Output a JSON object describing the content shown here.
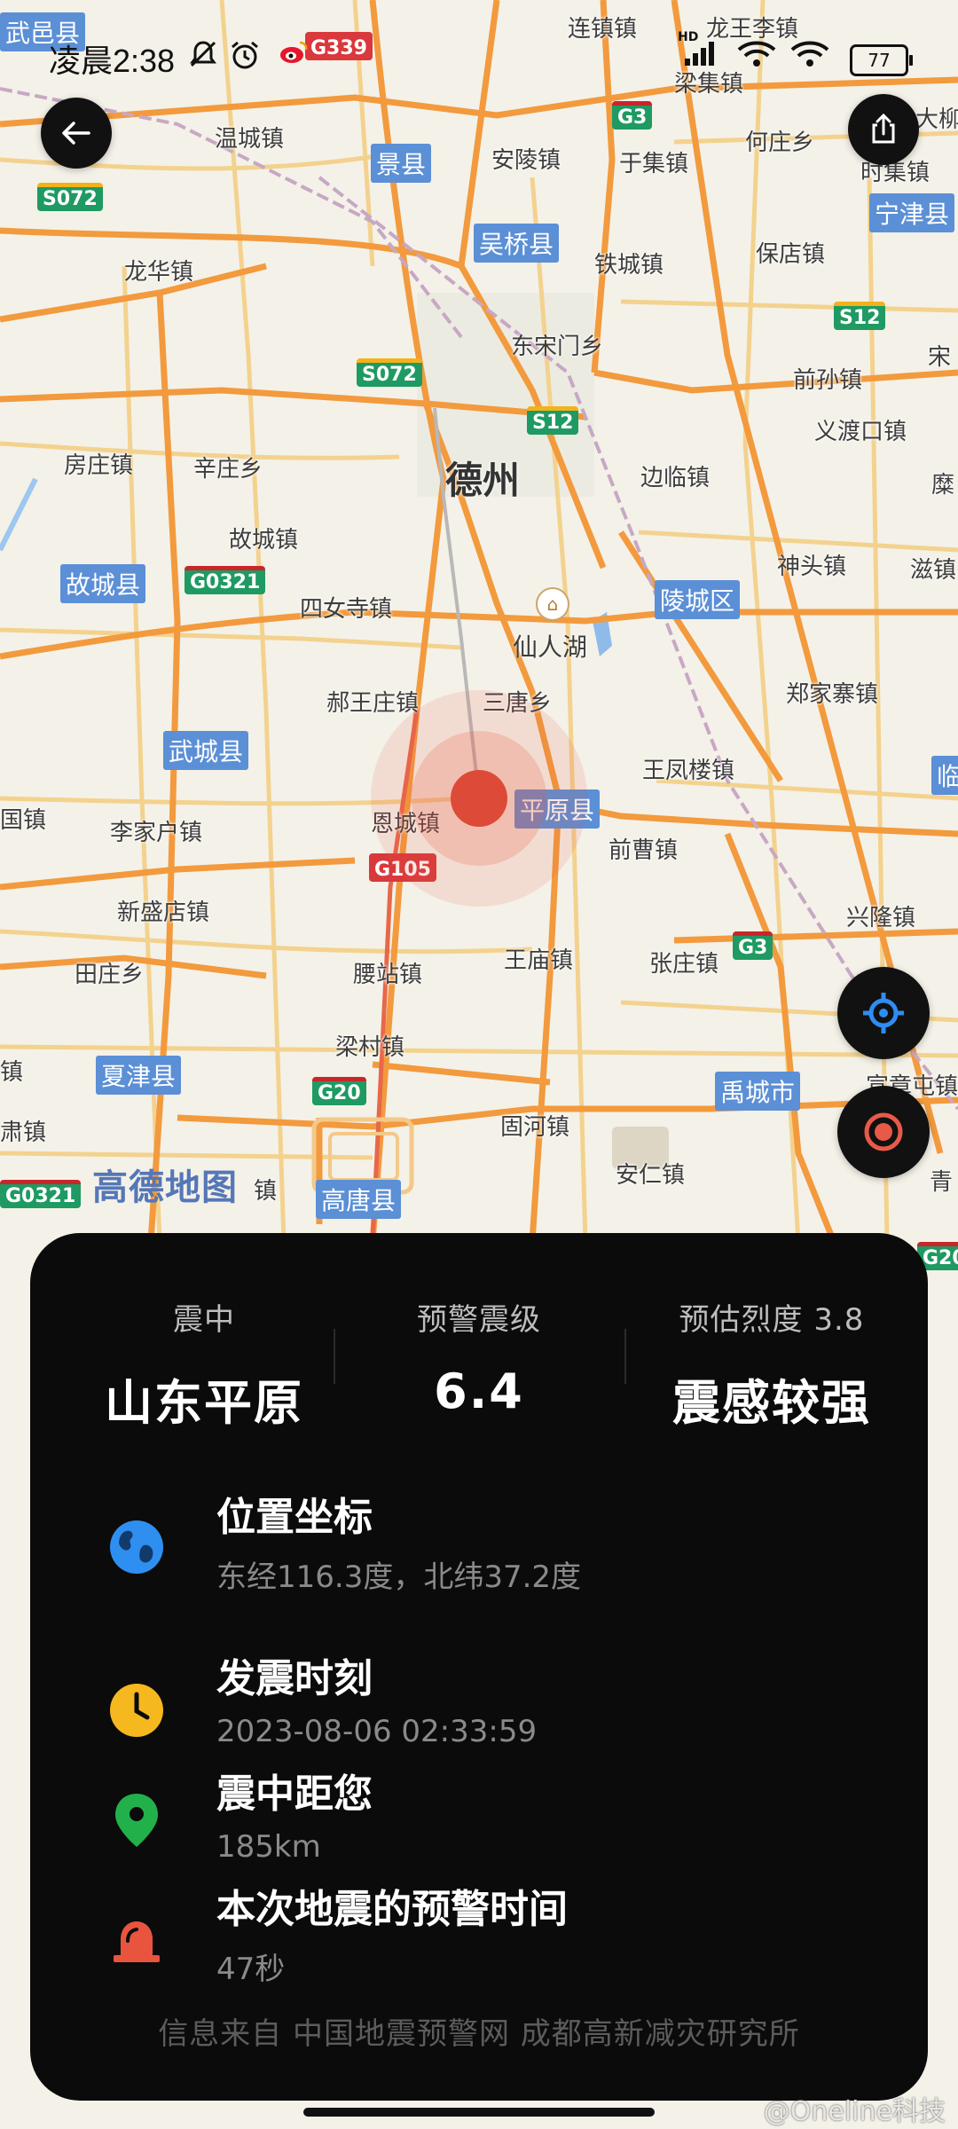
{
  "status_bar": {
    "time": "凌晨2:38",
    "battery": "77",
    "carrier_badge": "HD"
  },
  "map": {
    "watermark": "高德地图",
    "city": "德州",
    "lake": "仙人湖",
    "places": [
      "连镇镇",
      "龙王李镇",
      "梁集镇",
      "大柳",
      "温城镇",
      "安陵镇",
      "于集镇",
      "何庄乡",
      "时集镇",
      "龙华镇",
      "铁城镇",
      "保店镇",
      "东宋门乡",
      "前孙镇",
      "宋",
      "义渡口镇",
      "房庄镇",
      "辛庄乡",
      "边临镇",
      "糜",
      "故城镇",
      "神头镇",
      "滋镇",
      "四女寺镇",
      "郝王庄镇",
      "三唐乡",
      "郑家寨镇",
      "王凤楼镇",
      "李家户镇",
      "恩城镇",
      "前曹镇",
      "国镇",
      "新盛店镇",
      "兴隆镇",
      "田庄乡",
      "腰站镇",
      "王庙镇",
      "张庄镇",
      "梁村镇",
      "宣章屯镇",
      "固河镇",
      "安仁镇",
      "镇",
      "青",
      "肃镇",
      "镇"
    ],
    "counties": [
      "武邑县",
      "景县",
      "宁津县",
      "吴桥县",
      "故城县",
      "陵城区",
      "武城县",
      "平原县",
      "临",
      "夏津县",
      "禹城市",
      "高唐县"
    ],
    "shields": [
      "G339",
      "S072",
      "G3",
      "S072",
      "S12",
      "S12",
      "G0321",
      "G105",
      "G3",
      "G20",
      "G0321",
      "G20"
    ]
  },
  "panel": {
    "stats": [
      {
        "label": "震中",
        "value": "山东平原"
      },
      {
        "label": "预警震级",
        "value": "6.4"
      },
      {
        "label": "预估烈度 3.8",
        "value": "震感较强"
      }
    ],
    "rows": [
      {
        "title": "位置坐标",
        "sub": "东经116.3度，北纬37.2度",
        "icon": "globe-icon"
      },
      {
        "title": "发震时刻",
        "sub": "2023-08-06 02:33:59",
        "icon": "clock-icon"
      },
      {
        "title": "震中距您",
        "sub": "185km",
        "icon": "location-pin-icon"
      },
      {
        "title": "本次地震的预警时间",
        "sub": "47秒",
        "icon": "alarm-siren-icon"
      }
    ],
    "source": "信息来自 中国地震预警网 成都高新减灾研究所"
  },
  "buttons": {
    "back": "arrow-left-icon",
    "share": "share-icon",
    "locate": "crosshair-icon",
    "epicenter": "target-icon"
  },
  "credit": "@Oneline科技",
  "colors": {
    "panel_bg": "#0b0b0b",
    "epicenter": "#dd4a37",
    "locate_accent": "#2f8cf2",
    "epicenter_btn_accent": "#e85a47",
    "clock_icon": "#f6b81f",
    "pin_icon": "#22b04b",
    "globe_icon": "#2e8ff0",
    "siren_icon": "#e8543d"
  }
}
